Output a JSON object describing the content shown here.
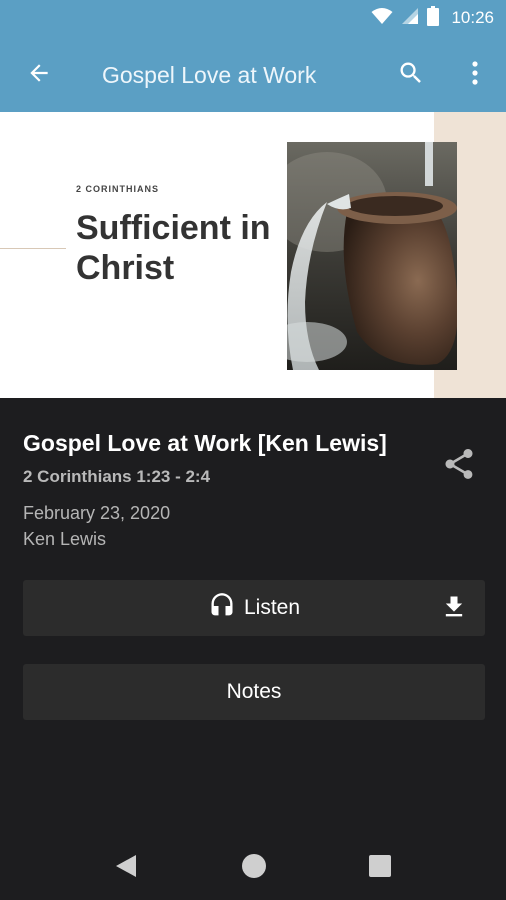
{
  "status_bar": {
    "time": "10:26",
    "icons": [
      "wifi-icon",
      "signal-icon",
      "battery-icon"
    ]
  },
  "app_bar": {
    "title": "Gospel Love at Work",
    "icons": [
      "back-arrow-icon",
      "search-icon",
      "more-vert-icon"
    ]
  },
  "hero": {
    "eyebrow": "2 CORINTHIANS",
    "title": "Sufficient in Christ"
  },
  "sermon": {
    "title": "Gospel Love at Work [Ken Lewis]",
    "passage": "2 Corinthians 1:23 - 2:4",
    "date": "February 23, 2020",
    "speaker": "Ken Lewis"
  },
  "actions": {
    "listen_label": "Listen",
    "notes_label": "Notes",
    "icons": [
      "headphones-icon",
      "download-icon",
      "share-icon"
    ]
  },
  "colors": {
    "app_bar": "#5b9fc4",
    "background": "#1d1d1f",
    "button": "#2c2c2c",
    "hero_accent": "#efe3d6"
  }
}
